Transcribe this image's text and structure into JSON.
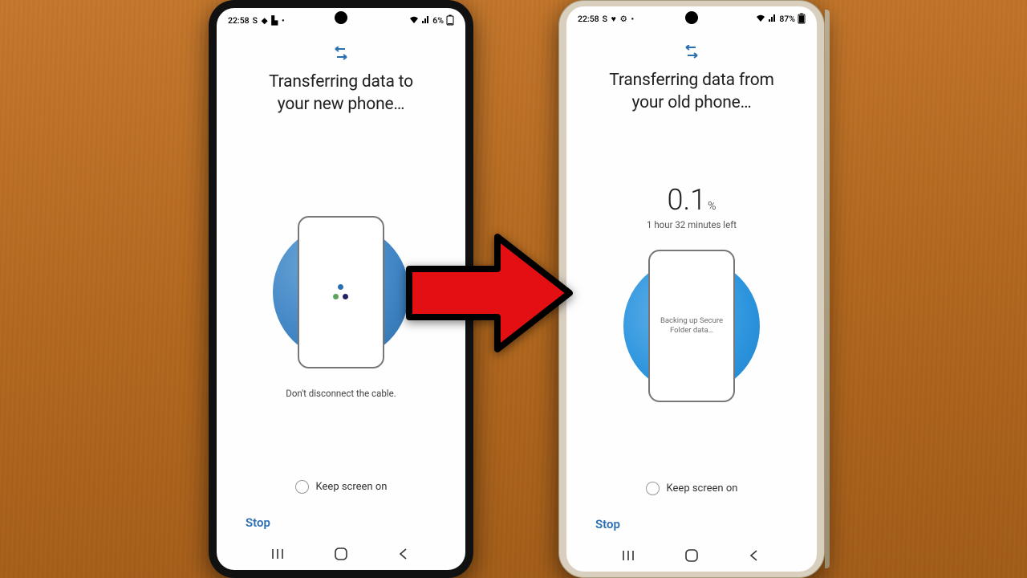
{
  "left": {
    "statusbar": {
      "time": "22:58",
      "indicators": "S ◆ ▙ •",
      "battery": "6%"
    },
    "title_line1": "Transferring data to",
    "title_line2": "your new phone…",
    "hint": "Don't disconnect the cable.",
    "keep_screen": "Keep screen on",
    "stop": "Stop"
  },
  "right": {
    "statusbar": {
      "time": "22:58",
      "indicators": "S ♥ ⚙ •",
      "battery": "87%"
    },
    "title_line1": "Transferring data from",
    "title_line2": "your old phone…",
    "progress_value": "0.1",
    "progress_unit": "%",
    "time_left": "1 hour 32 minutes left",
    "backup_text": "Backing up Secure Folder data…",
    "keep_screen": "Keep screen on",
    "stop": "Stop"
  }
}
